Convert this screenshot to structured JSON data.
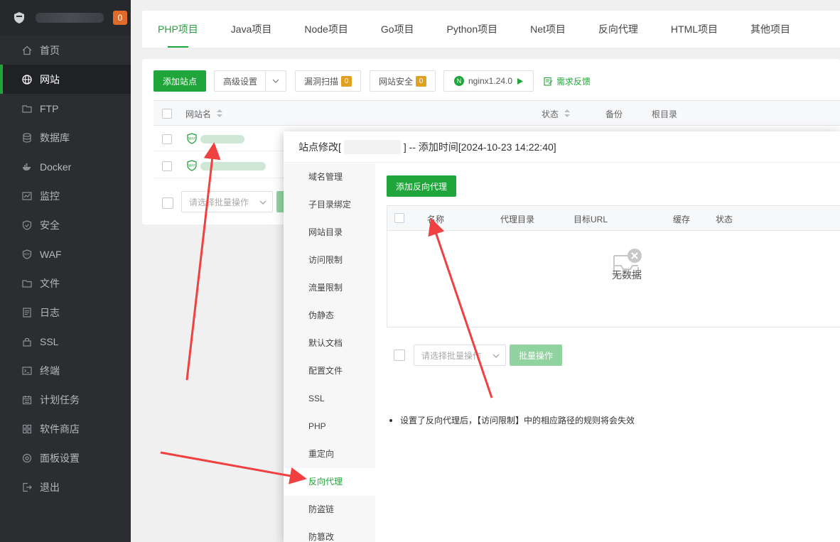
{
  "sidebar": {
    "badge": "0",
    "items": [
      {
        "label": "首页",
        "icon": "home-icon"
      },
      {
        "label": "网站",
        "icon": "globe-icon"
      },
      {
        "label": "FTP",
        "icon": "ftp-icon"
      },
      {
        "label": "数据库",
        "icon": "database-icon"
      },
      {
        "label": "Docker",
        "icon": "docker-icon"
      },
      {
        "label": "监控",
        "icon": "monitor-icon"
      },
      {
        "label": "安全",
        "icon": "shield-icon"
      },
      {
        "label": "WAF",
        "icon": "waf-icon"
      },
      {
        "label": "文件",
        "icon": "folder-icon"
      },
      {
        "label": "日志",
        "icon": "log-icon"
      },
      {
        "label": "SSL",
        "icon": "ssl-icon"
      },
      {
        "label": "终端",
        "icon": "terminal-icon"
      },
      {
        "label": "计划任务",
        "icon": "calendar-icon"
      },
      {
        "label": "软件商店",
        "icon": "store-icon"
      },
      {
        "label": "面板设置",
        "icon": "settings-icon"
      },
      {
        "label": "退出",
        "icon": "logout-icon"
      }
    ]
  },
  "tabs": [
    "PHP项目",
    "Java项目",
    "Node项目",
    "Go项目",
    "Python项目",
    "Net项目",
    "反向代理",
    "HTML项目",
    "其他项目"
  ],
  "toolbar": {
    "add_site": "添加站点",
    "advanced": "高级设置",
    "vuln_scan": "漏洞扫描",
    "vuln_count": "0",
    "site_security": "网站安全",
    "security_count": "0",
    "nginx": "nginx1.24.0",
    "feedback": "需求反馈"
  },
  "table": {
    "headers": {
      "name": "网站名",
      "status": "状态",
      "backup": "备份",
      "root": "根目录"
    },
    "batch_placeholder": "请选择批量操作"
  },
  "modal": {
    "title_prefix": "站点修改[",
    "title_suffix": "] -- 添加时间[2024-10-23 14:22:40]",
    "nav": [
      "域名管理",
      "子目录绑定",
      "网站目录",
      "访问限制",
      "流量限制",
      "伪静态",
      "默认文档",
      "配置文件",
      "SSL",
      "PHP",
      "重定向",
      "反向代理",
      "防盗链",
      "防篡改"
    ],
    "add_proxy": "添加反向代理",
    "proxy_headers": {
      "name": "名称",
      "dir": "代理目录",
      "url": "目标URL",
      "cache": "缓存",
      "status": "状态"
    },
    "empty_text": "无数据",
    "batch_placeholder": "请选择批量操作",
    "batch_button": "批量操作",
    "note": "设置了反向代理后，【访问限制】中的相应路径的规则将会失效"
  },
  "colors": {
    "brand": "#20a53a",
    "sidebar_bg": "#2b2d31",
    "badge": "#e06a2a",
    "arrow": "#f04040"
  }
}
